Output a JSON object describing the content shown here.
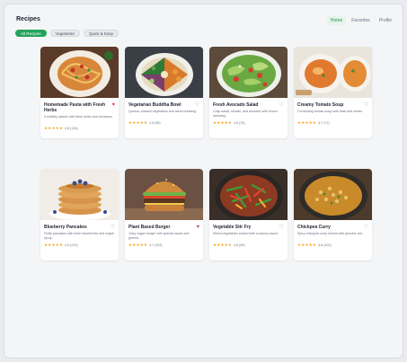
{
  "app": {
    "title": "Recipes"
  },
  "nav": [
    {
      "label": "Home",
      "active": true
    },
    {
      "label": "Favorites",
      "active": false
    },
    {
      "label": "Profile",
      "active": false
    }
  ],
  "filters": [
    {
      "label": "All Recipes",
      "active": true
    },
    {
      "label": "Vegetarian",
      "active": false
    },
    {
      "label": "Quick & Easy",
      "active": false
    }
  ],
  "recipes": [
    {
      "name": "Homemade Pasta with Fresh Herbs",
      "desc": "A healthy classic with fresh herbs and tomatoes.",
      "stars": "★★★★★",
      "rating": "4.8 (128)",
      "favorite": true,
      "photo_icon": "pasta-photo"
    },
    {
      "name": "Vegetarian Buddha Bowl",
      "desc": "Quinoa, roasted vegetables and tahini dressing.",
      "stars": "★★★★★",
      "rating": "4.6 (98)",
      "favorite": false,
      "photo_icon": "buddha-bowl-photo"
    },
    {
      "name": "Fresh Avocado Salad",
      "desc": "Crisp salad, tomato, and avocado with lemon dressing.",
      "stars": "★★★★★",
      "rating": "4.8 (76)",
      "favorite": false,
      "photo_icon": "avocado-salad-photo"
    },
    {
      "name": "Creamy Tomato Soup",
      "desc": "Comforting tomato soup with basil and cream.",
      "stars": "★★★★★",
      "rating": "4.7 (71)",
      "favorite": false,
      "photo_icon": "tomato-soup-photo"
    },
    {
      "name": "Blueberry Pancakes",
      "desc": "Fluffy pancakes with fresh blueberries and maple syrup.",
      "stars": "★★★★★",
      "rating": "4.9 (213)",
      "favorite": false,
      "photo_icon": "pancakes-photo"
    },
    {
      "name": "Plant Based Burger",
      "desc": "Juicy vegan burger with special sauce and greens.",
      "stars": "★★★★★",
      "rating": "4.7 (103)",
      "favorite": true,
      "photo_icon": "burger-photo"
    },
    {
      "name": "Vegetable Stir Fry",
      "desc": "Mixed vegetables tossed with a savory sauce.",
      "stars": "★★★★★",
      "rating": "4.6 (89)",
      "favorite": false,
      "photo_icon": "stir-fry-photo"
    },
    {
      "name": "Chickpea Curry",
      "desc": "Spicy chickpea curry served with jasmine rice.",
      "stars": "★★★★★",
      "rating": "4.8 (102)",
      "favorite": false,
      "photo_icon": "curry-photo"
    }
  ],
  "icons": {
    "heart": "♥",
    "heart_outline": "♡"
  },
  "colors": {
    "accent": "#22a45a",
    "favorite": "#e2485d",
    "star": "#f5a623"
  }
}
